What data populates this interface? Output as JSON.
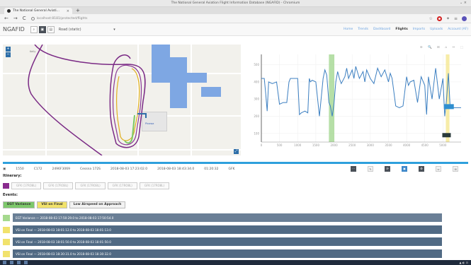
{
  "window": {
    "title": "The National General Aviation Flight Information Database (NGAFID) - Chromium",
    "controls": "⌄  ×"
  },
  "tab": {
    "title": "The National General Aviati...",
    "close": "×",
    "new_tab": "+"
  },
  "browser": {
    "url": "localhost:8181/protected/flights",
    "back": "←",
    "forward": "→",
    "reload": "C"
  },
  "app": {
    "brand": "NGAFID",
    "map_layer": "Road (static)",
    "nav": [
      "Home",
      "Trends",
      "Dashboard",
      "Flights",
      "Imports",
      "Uploads",
      "Account (AF)"
    ],
    "active_nav": "Flights"
  },
  "map": {
    "place_labels": [
      "Kelly",
      "Pinawa"
    ],
    "zoom_in": "+",
    "zoom_out": "−",
    "fullscreen": "⤢"
  },
  "chart_data": {
    "type": "line",
    "title": "",
    "xlabel": "",
    "ylabel": "",
    "xlim": [
      0,
      5500
    ],
    "ylim": [
      50,
      560
    ],
    "xticks": [
      0,
      500,
      1000,
      1500,
      2000,
      2500,
      3000,
      3500,
      4000,
      4500,
      5000
    ],
    "yticks": [
      100,
      200,
      300,
      400,
      500
    ],
    "highlight_regions": [
      {
        "x": [
          1860,
          2010
        ],
        "color": "#9ed48a"
      },
      {
        "x": [
          5080,
          5180
        ],
        "color": "#f4e58a"
      }
    ],
    "series": [
      {
        "color": "#3c7fc1",
        "x": [
          0,
          80,
          120,
          160,
          200,
          300,
          420,
          500,
          600,
          700,
          760,
          800,
          900,
          1000,
          1050,
          1100,
          1200,
          1280,
          1320,
          1350,
          1400,
          1500,
          1600,
          1700,
          1750,
          1800,
          1860,
          1900,
          1950,
          2000,
          2050,
          2100,
          2150,
          2200,
          2300,
          2350,
          2400,
          2500,
          2550,
          2600,
          2700,
          2800,
          2850,
          2900,
          3000,
          3100,
          3200,
          3300,
          3400,
          3500,
          3550,
          3600,
          3700,
          3800,
          3900,
          4000,
          4050,
          4100,
          4200,
          4300,
          4400,
          4500,
          4550,
          4600,
          4700,
          4800,
          4900,
          5000,
          5050,
          5100,
          5150,
          5200,
          5300,
          5400,
          5500
        ],
        "y": [
          420,
          420,
          330,
          230,
          400,
          390,
          400,
          270,
          280,
          280,
          400,
          420,
          420,
          420,
          210,
          220,
          230,
          220,
          420,
          400,
          410,
          400,
          200,
          420,
          470,
          440,
          280,
          260,
          200,
          270,
          400,
          460,
          420,
          390,
          430,
          480,
          420,
          470,
          420,
          490,
          420,
          460,
          400,
          470,
          420,
          390,
          480,
          430,
          470,
          400,
          450,
          420,
          260,
          250,
          260,
          430,
          380,
          400,
          410,
          280,
          430,
          380,
          210,
          430,
          300,
          480,
          300,
          420,
          200,
          300,
          450,
          250,
          250,
          250,
          250
        ]
      }
    ],
    "annotations": [
      {
        "text": "",
        "x": 5300,
        "y": 250
      },
      {
        "text": "",
        "x": 5100,
        "y": 90
      }
    ]
  },
  "flight_info": {
    "checkbox": "▣",
    "flight_id": "1550",
    "tail": "C172",
    "system_id": "2496F3069",
    "model": "Cessna 172S",
    "start": "2018-08-03 17:23:02.0",
    "end": "2018-08-03 18:43:34.0",
    "duration": "01:20:32",
    "airport": "GFK",
    "buttons": [
      "⋯",
      "✎",
      "⟳",
      "▣",
      "⚙",
      "⇔",
      "⊞"
    ]
  },
  "itinerary": {
    "label": "Itinerary:",
    "stops": [
      "GFK (17RO8L)",
      "GFK (17RO8L)",
      "GFK (17RO8L)",
      "GFK (17RO8L)",
      "GFK (17RO8L)"
    ]
  },
  "events": {
    "label": "Events:",
    "types": [
      {
        "name": "EGT Variance",
        "bg": "#7dc86b"
      },
      {
        "name": "VSI on Final",
        "bg": "#f1e26c"
      },
      {
        "name": "Low Airspeed on Approach",
        "bg": "#f2f2f2"
      }
    ],
    "list": [
      {
        "text": "EGT Variance — 2018-08-03 17:50:29.0 to 2018-08-03 17:50:54.0",
        "chk": "#a5d98e",
        "bar": "#6a7f96"
      },
      {
        "text": "VSI on Final — 2018-08-03 18:01:12.0 to 2018-08-03 18:01:13.0",
        "chk": "#f1e26c",
        "bar": "#516a84"
      },
      {
        "text": "VSI on Final — 2018-08-03 18:01:50.0 to 2018-08-03 18:01:50.0",
        "chk": "#f1e26c",
        "bar": "#516a84"
      },
      {
        "text": "VSI on Final — 2018-08-03 18:30:31.0 to 2018-08-03 18:30:32.0",
        "chk": "#f1e26c",
        "bar": "#516a84"
      }
    ]
  }
}
